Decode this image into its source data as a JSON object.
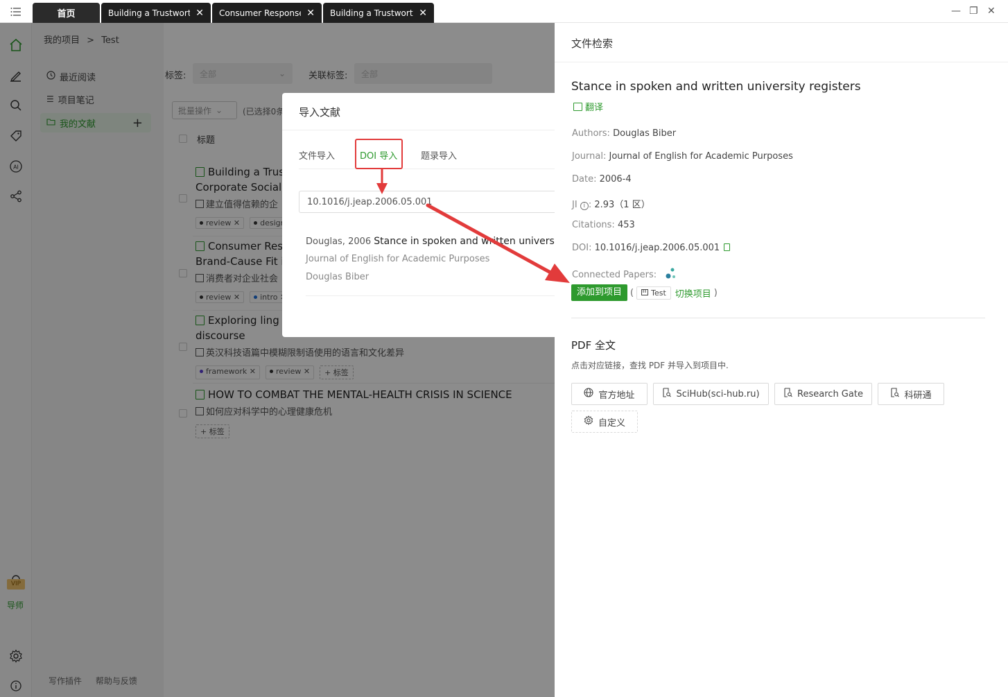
{
  "tabs": [
    {
      "label": "首页"
    },
    {
      "label": "Building a Trustworth..."
    },
    {
      "label": "Consumer Responses..."
    },
    {
      "label": "Building a Trustworth..."
    }
  ],
  "breadcrumb": {
    "root": "我的项目",
    "sep": ">",
    "current": "Test"
  },
  "sidebar": {
    "vip": "VIP",
    "tutor": "导师"
  },
  "nav": {
    "recent": "最近阅读",
    "notes": "项目笔记",
    "my_docs": "我的文献",
    "footer": [
      "写作插件",
      "帮助与反馈"
    ]
  },
  "filters": {
    "tag_label": "标签:",
    "tag_value": "全部",
    "rel_label": "关联标签:",
    "rel_value": "全部",
    "batch": "批量操作",
    "selected": "(已选择0条",
    "col_title": "标题"
  },
  "documents": [
    {
      "title1": "Building a Trus",
      "title2": "Corporate Social",
      "cn": "建立值得信赖的企",
      "tags": [
        "review",
        "design"
      ]
    },
    {
      "title1": "Consumer Res",
      "title2": "Brand-Cause Fit i",
      "cn": "消费者对企业社会",
      "tags": [
        "review",
        "intro"
      ]
    },
    {
      "title1": "Exploring ling",
      "title2": "discourse",
      "cn": "英汉科技语篇中模糊限制语使用的语言和文化差异",
      "tags": [
        "framework",
        "review"
      ],
      "add": "标签"
    },
    {
      "title1": "HOW TO COMBAT THE MENTAL-HEALTH CRISIS IN SCIENCE",
      "title2": "",
      "cn": "如何应对科学中的心理健康危机",
      "tags": [],
      "add": "标签"
    }
  ],
  "modal": {
    "title": "导入文献",
    "tabs": [
      "文件导入",
      "DOI 导入",
      "题录导入"
    ],
    "doi": "10.1016/j.jeap.2006.05.001",
    "result": {
      "prefix": "Douglas, 2006",
      "title": "Stance in spoken and written univers",
      "journal": "Journal of English for Academic Purposes",
      "author": "Douglas Biber"
    }
  },
  "panel": {
    "header": "文件检索",
    "title": "Stance in spoken and written university registers",
    "translate": "翻译",
    "meta": {
      "authors_label": "Authors:",
      "authors": "Douglas Biber",
      "journal_label": "Journal:",
      "journal": "Journal of English for Academic Purposes",
      "date_label": "Date:",
      "date": "2006-4",
      "ji_label": "JI",
      "ji_colon": ":",
      "ji": "2.93（1 区）",
      "citations_label": "Citations:",
      "citations": "453",
      "doi_label": "DOI:",
      "doi": "10.1016/j.jeap.2006.05.001",
      "connected_label": "Connected Papers:"
    },
    "add_button": "添加到项目",
    "paren_open": "(",
    "project_chip": "Test",
    "switch_project": "切换项目",
    "paren_close": ")",
    "pdf_header": "PDF 全文",
    "pdf_desc": "点击对应链接，查找 PDF 并导入到项目中.",
    "sources": [
      "官方地址",
      "SciHub(sci-hub.ru)",
      "Research Gate",
      "科研通",
      "自定义"
    ]
  },
  "colors": {
    "accent": "#2e9a2e",
    "annotation": "#e23b3b"
  }
}
